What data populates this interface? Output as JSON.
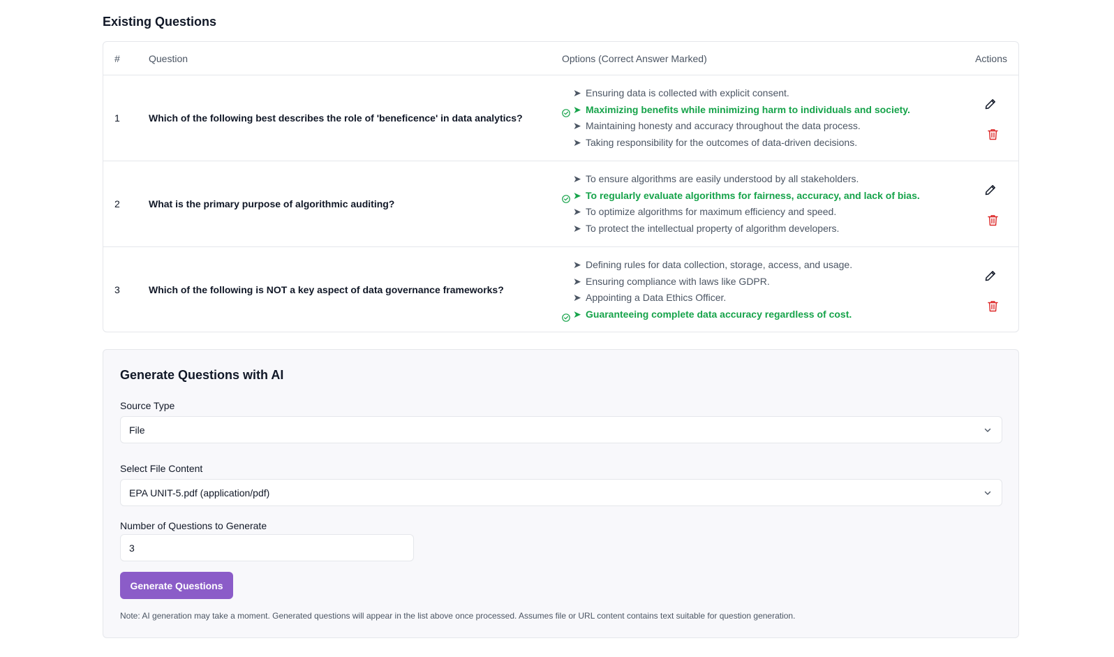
{
  "existing": {
    "title": "Existing Questions",
    "columns": {
      "num": "#",
      "question": "Question",
      "options": "Options (Correct Answer Marked)",
      "actions": "Actions"
    },
    "rows": [
      {
        "num": "1",
        "question": "Which of the following best describes the role of 'beneficence' in data analytics?",
        "options": [
          {
            "text": "Ensuring data is collected with explicit consent.",
            "correct": false
          },
          {
            "text": "Maximizing benefits while minimizing harm to individuals and society.",
            "correct": true
          },
          {
            "text": "Maintaining honesty and accuracy throughout the data process.",
            "correct": false
          },
          {
            "text": "Taking responsibility for the outcomes of data-driven decisions.",
            "correct": false
          }
        ]
      },
      {
        "num": "2",
        "question": "What is the primary purpose of algorithmic auditing?",
        "options": [
          {
            "text": "To ensure algorithms are easily understood by all stakeholders.",
            "correct": false
          },
          {
            "text": "To regularly evaluate algorithms for fairness, accuracy, and lack of bias.",
            "correct": true
          },
          {
            "text": "To optimize algorithms for maximum efficiency and speed.",
            "correct": false
          },
          {
            "text": "To protect the intellectual property of algorithm developers.",
            "correct": false
          }
        ]
      },
      {
        "num": "3",
        "question": "Which of the following is NOT a key aspect of data governance frameworks?",
        "options": [
          {
            "text": "Defining rules for data collection, storage, access, and usage.",
            "correct": false
          },
          {
            "text": "Ensuring compliance with laws like GDPR.",
            "correct": false
          },
          {
            "text": "Appointing a Data Ethics Officer.",
            "correct": false
          },
          {
            "text": "Guaranteeing complete data accuracy regardless of cost.",
            "correct": true
          }
        ]
      }
    ]
  },
  "generator": {
    "title": "Generate Questions with AI",
    "source_type_label": "Source Type",
    "source_type_value": "File",
    "file_content_label": "Select File Content",
    "file_content_value": "EPA UNIT-5.pdf (application/pdf)",
    "count_label": "Number of Questions to Generate",
    "count_value": "3",
    "button_label": "Generate Questions",
    "note": "Note: AI generation may take a moment. Generated questions will appear in the list above once processed. Assumes file or URL content contains text suitable for question generation."
  },
  "colors": {
    "correct": "#16a34a",
    "delete": "#dc2626",
    "accent": "#8b5cc8"
  },
  "icons": {
    "edit": "pencil-icon",
    "delete": "trash-icon",
    "correct": "check-circle-icon",
    "option": "arrow-right-icon",
    "select": "chevron-down-icon"
  }
}
